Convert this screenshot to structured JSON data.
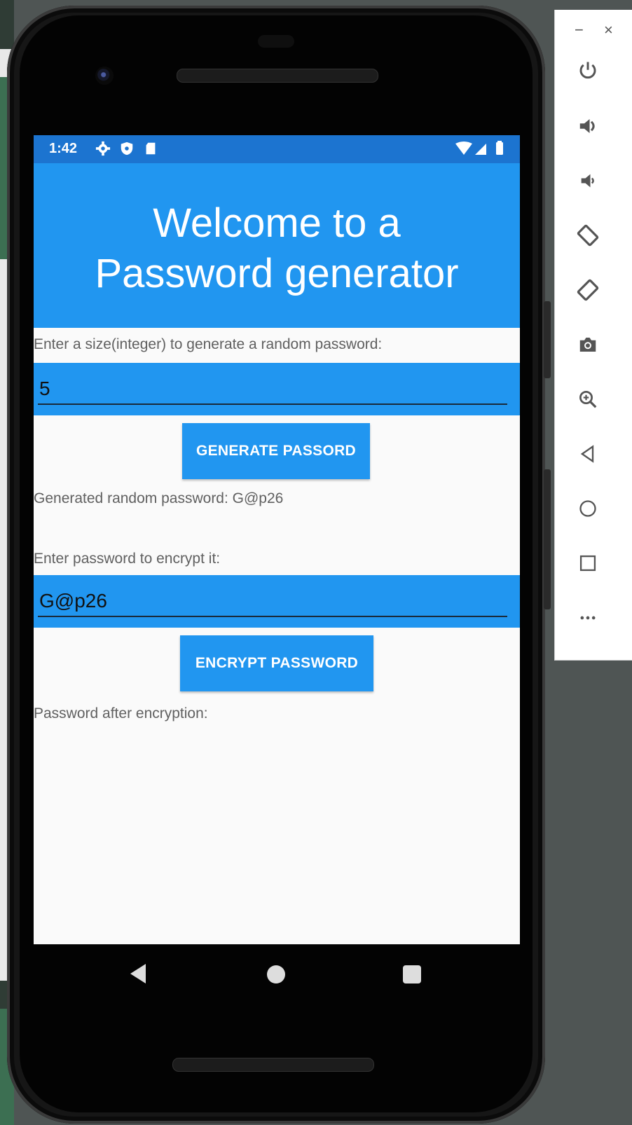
{
  "status_bar": {
    "time": "1:42"
  },
  "app": {
    "title_line1": "Welcome to a",
    "title_line2": "Password generator",
    "size_label": "Enter a size(integer) to generate a random password:",
    "size_value": "5",
    "generate_button": "GENERATE PASSORD",
    "generated_text": "Generated random password: G@p26",
    "encrypt_label": "Enter password to encrypt it:",
    "encrypt_value": "G@p26",
    "encrypt_button": "ENCRYPT PASSWORD",
    "encrypted_text": "Password after encryption:"
  },
  "emulator_toolbar": {
    "minimize": "−",
    "close": "×",
    "buttons": [
      "power-icon",
      "volume-up-icon",
      "volume-down-icon",
      "rotate-left-icon",
      "rotate-right-icon",
      "camera-icon",
      "zoom-icon",
      "back-icon",
      "home-icon",
      "overview-icon",
      "more-icon"
    ]
  },
  "colors": {
    "app_bar": "#2196f0",
    "status_bar": "#1c74d0",
    "screen_bg": "#fafafa"
  }
}
